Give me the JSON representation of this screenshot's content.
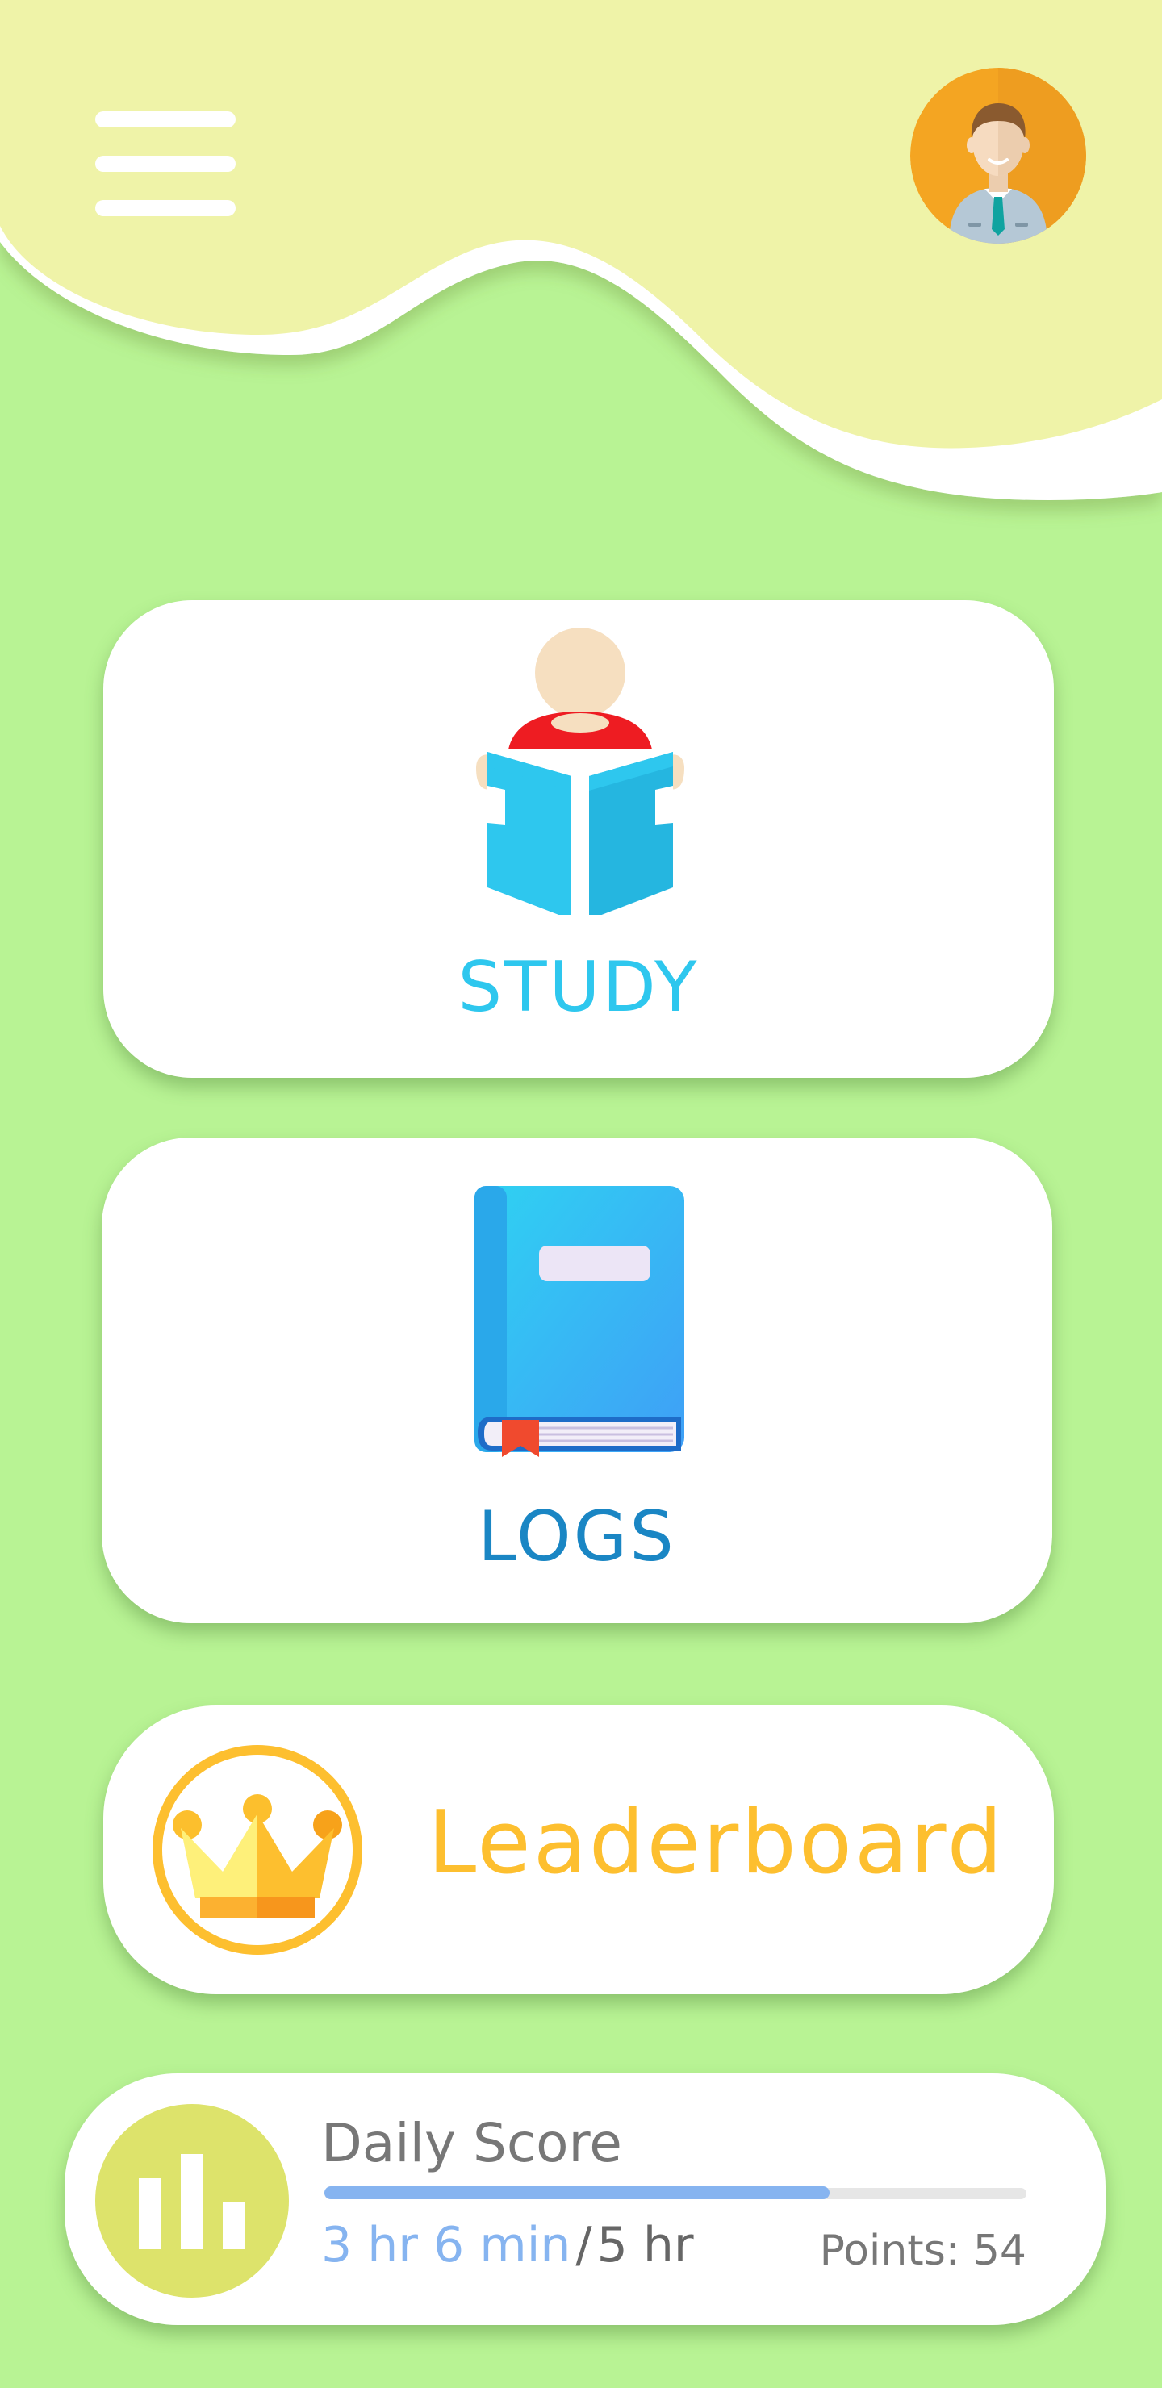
{
  "header": {
    "menu_icon": "hamburger-menu-icon",
    "avatar_icon": "user-avatar-icon"
  },
  "cards": {
    "study": {
      "label": "STUDY",
      "icon": "reading-person-icon"
    },
    "logs": {
      "label": "LOGS",
      "icon": "book-icon"
    },
    "leaderboard": {
      "label": "Leaderboard",
      "icon": "crown-icon"
    }
  },
  "score": {
    "title": "Daily Score",
    "time_done": "3 hr 6 min",
    "separator": "/",
    "time_goal": "5 hr",
    "points": "Points: 54",
    "progress_percent": 72,
    "icon": "bar-chart-icon"
  },
  "colors": {
    "background": "#b8f394",
    "header_wave": "#eff3a8",
    "study": "#2ec7ee",
    "logs": "#1a86c4",
    "leaderboard": "#fdbf2f",
    "progress": "#86b4f0",
    "score_icon_bg": "#dde36b"
  }
}
